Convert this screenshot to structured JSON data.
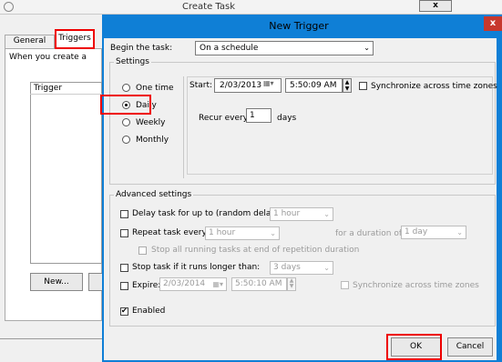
{
  "background_window": {
    "title": "Create Task",
    "close_label": "x",
    "tabs": [
      "General",
      "Triggers"
    ],
    "description": "When you create a",
    "trigger_column": "Trigger",
    "new_button": "New..."
  },
  "dialog": {
    "title": "New Trigger",
    "close_label": "x",
    "begin_label": "Begin the task:",
    "begin_value": "On a schedule",
    "settings_label": "Settings",
    "schedule_options": [
      "One time",
      "Daily",
      "Weekly",
      "Monthly"
    ],
    "selected_schedule": "Daily",
    "start_label": "Start:",
    "start_date": "2/03/2013",
    "start_time": "5:50:09 AM",
    "sync_label": "Synchronize across time zones",
    "sync_checked": false,
    "recur_label": "Recur every:",
    "recur_value": "1",
    "recur_unit": "days",
    "advanced_label": "Advanced settings",
    "delay_label": "Delay task for up to (random delay):",
    "delay_value": "1 hour",
    "repeat_label": "Repeat task every:",
    "repeat_value": "1 hour",
    "duration_label": "for a duration of:",
    "duration_value": "1 day",
    "stop_running_label": "Stop all running tasks at end of repetition duration",
    "stop_longer_label": "Stop task if it runs longer than:",
    "stop_longer_value": "3 days",
    "expire_label": "Expire:",
    "expire_date": "2/03/2014",
    "expire_time": "5:50:10 AM",
    "expire_sync_label": "Synchronize across time zones",
    "enabled_label": "Enabled",
    "enabled_checked": true,
    "ok_label": "OK",
    "cancel_label": "Cancel"
  },
  "colors": {
    "dialog_frame": "#0f7fd6",
    "close_button": "#c7382d",
    "highlight": "#e00000"
  }
}
